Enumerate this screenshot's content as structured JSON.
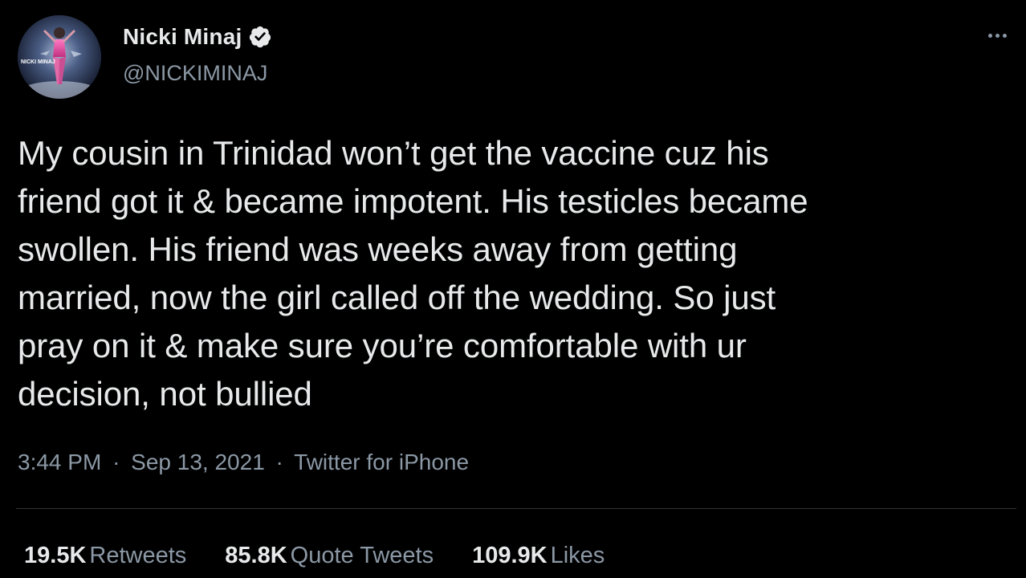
{
  "author": {
    "display_name": "Nicki Minaj",
    "handle": "@NICKIMINAJ",
    "verified": true,
    "avatar_icon": "profile-photo",
    "avatar_logo_text": "NICKI MINAJ"
  },
  "tweet": {
    "text": "My cousin in Trinidad won’t get the vaccine cuz his\nfriend got it & became impotent. His testicles became\nswollen. His friend was weeks away from getting\nmarried, now the girl called off the wedding. So just\npray on it & make sure you’re comfortable with ur\ndecision, not bullied"
  },
  "meta": {
    "time": "3:44 PM",
    "separator": "·",
    "date": "Sep 13, 2021",
    "source": "Twitter for iPhone"
  },
  "stats": {
    "retweets_count": "19.5K",
    "retweets_label": "Retweets",
    "quotes_count": "85.8K",
    "quotes_label": "Quote Tweets",
    "likes_count": "109.9K",
    "likes_label": "Likes"
  },
  "colors": {
    "background": "#000000",
    "primary_text": "#e7e9ea",
    "secondary_text": "#8b98a5",
    "divider": "#2f3336",
    "verified_badge": "#e7e9ea"
  }
}
